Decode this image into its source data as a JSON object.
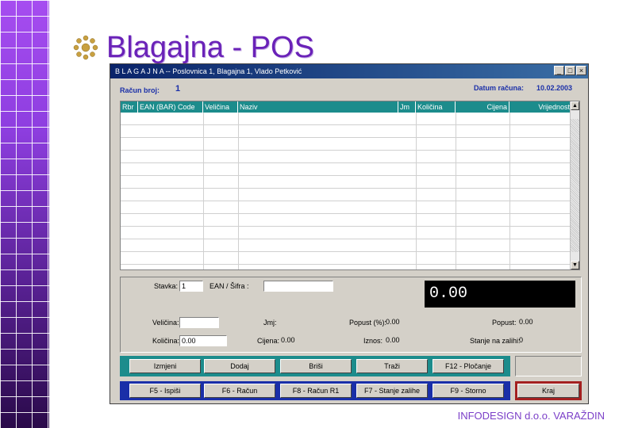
{
  "slide": {
    "title": "Blagajna - POS",
    "footer": "INFODESIGN d.o.o. VARAŽDIN"
  },
  "window": {
    "title": "B L A G A J N A -- Poslovnica 1, Blagajna 1, Vlado Petković",
    "buttons": [
      "_",
      "□",
      "×"
    ]
  },
  "header": {
    "racun_label": "Račun broj:",
    "racun_value": "1",
    "datum_label": "Datum računa:",
    "datum_value": "10.02.2003"
  },
  "grid": {
    "columns": [
      "Rbr",
      "EAN (BAR) Code",
      "Veličina",
      "Naziv",
      "Jm",
      "Količina",
      "Cijena",
      "Vrijednost"
    ],
    "rows": []
  },
  "form": {
    "stavka_label": "Stavka:",
    "stavka_value": "1",
    "ean_label": "EAN / Šifra :",
    "ean_value": "",
    "total": "0.00",
    "velicina_label": "Veličina:",
    "velicina_value": "",
    "jmj_label": "Jmj:",
    "jmj_value": "",
    "popust_pct_label": "Popust (%):",
    "popust_pct_value": "0.00",
    "popust_label": "Popust:",
    "popust_value": "0.00",
    "kolicina_label": "Količina:",
    "kolicina_value": "0.00",
    "cijena_label": "Cijena:",
    "cijena_value": "0.00",
    "iznos_label": "Iznos:",
    "iznos_value": "0.00",
    "stanje_label": "Stanje na zalihi:",
    "stanje_value": "0"
  },
  "buttons_row1": [
    "Izmjeni",
    "Dodaj",
    "Briši",
    "Traži",
    "F12 - Pločanje"
  ],
  "buttons_row2": [
    "F5 - Ispiši",
    "F6 - Račun",
    "F8 - Račun R1",
    "F7 - Stanje zalihe",
    "F9 - Storno"
  ],
  "kraj_label": "Kraj"
}
